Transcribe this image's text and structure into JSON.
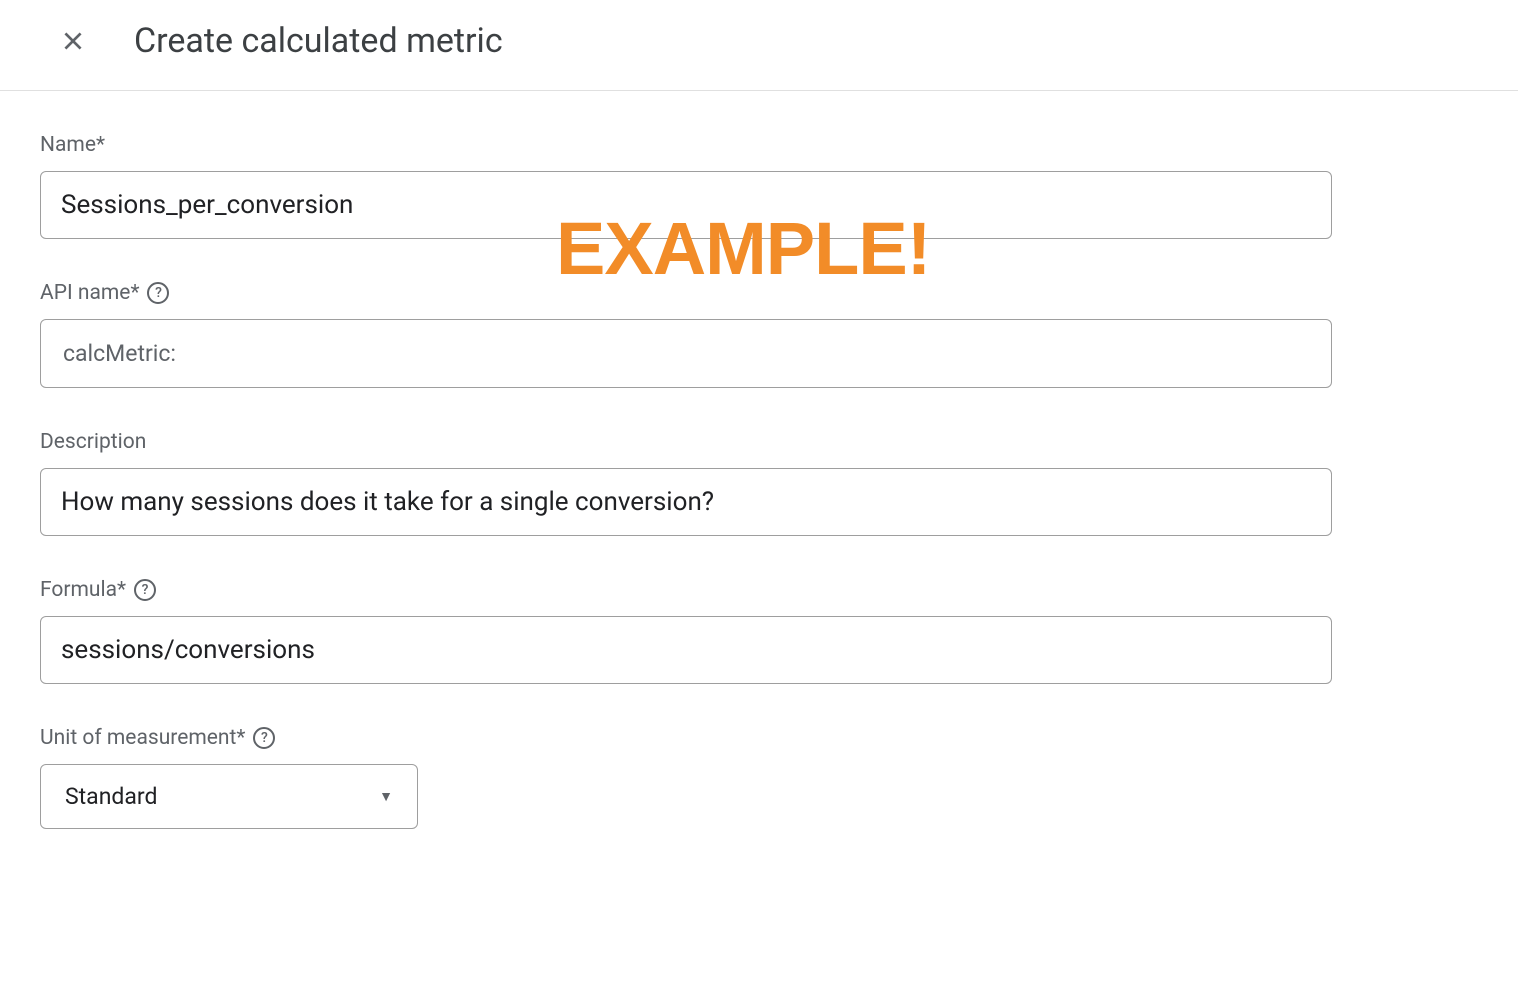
{
  "header": {
    "title": "Create calculated metric"
  },
  "watermark": "EXAMPLE!",
  "fields": {
    "name": {
      "label": "Name*",
      "value": "Sessions_per_conversion"
    },
    "apiName": {
      "label": "API name*",
      "prefix": "calcMetric:"
    },
    "description": {
      "label": "Description",
      "value": "How many sessions does it take for a single conversion?"
    },
    "formula": {
      "label": "Formula*",
      "value": "sessions/conversions"
    },
    "unit": {
      "label": "Unit of measurement*",
      "selected": "Standard"
    }
  }
}
